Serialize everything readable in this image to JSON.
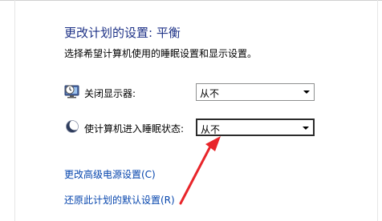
{
  "header": {
    "title": "更改计划的设置: 平衡",
    "subtitle": "选择希望计算机使用的睡眠设置和显示设置。"
  },
  "settings": {
    "display_off": {
      "label": "关闭显示器:",
      "value": "从不",
      "icon": "monitor-clock-icon"
    },
    "sleep": {
      "label": "使计算机进入睡眠状态:",
      "value": "从不",
      "icon": "moon-sleep-icon"
    }
  },
  "links": {
    "advanced": "更改高级电源设置(C)",
    "restore": "还原此计划的默认设置(R)"
  },
  "annotation": {
    "arrow_color": "#e8252a"
  }
}
